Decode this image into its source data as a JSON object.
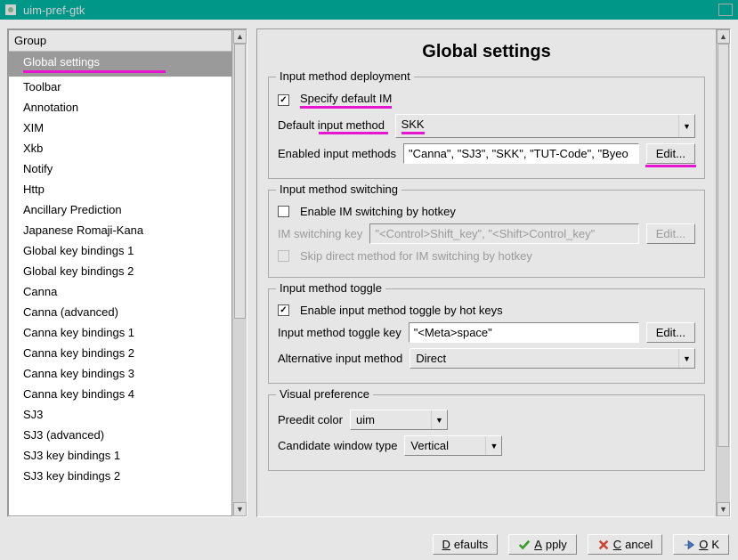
{
  "window": {
    "title": "uim-pref-gtk"
  },
  "sidebar": {
    "header": "Group",
    "items": [
      "Global settings",
      "Toolbar",
      "Annotation",
      "XIM",
      "Xkb",
      "Notify",
      "Http",
      "Ancillary Prediction",
      "Japanese Romaji-Kana",
      "Global key bindings 1",
      "Global key bindings 2",
      "Canna",
      "Canna (advanced)",
      "Canna key bindings 1",
      "Canna key bindings 2",
      "Canna key bindings 3",
      "Canna key bindings 4",
      "SJ3",
      "SJ3 (advanced)",
      "SJ3 key bindings 1",
      "SJ3 key bindings 2"
    ],
    "selected_index": 0
  },
  "page": {
    "title": "Global settings",
    "groups": {
      "deployment": {
        "title": "Input method deployment",
        "specify_default_label": "Specify default IM",
        "specify_default_checked": true,
        "default_im_label": "Default input method",
        "default_im_value": "SKK",
        "enabled_im_label": "Enabled input methods",
        "enabled_im_value": "\"Canna\", \"SJ3\", \"SKK\", \"TUT-Code\", \"Byeo",
        "edit_label": "Edit..."
      },
      "switching": {
        "title": "Input method switching",
        "enable_label": "Enable IM switching by hotkey",
        "enable_checked": false,
        "key_label": "IM switching key",
        "key_value": "\"<Control>Shift_key\", \"<Shift>Control_key\"",
        "edit_label": "Edit...",
        "skip_label": "Skip direct method for IM switching by hotkey",
        "skip_checked": false
      },
      "toggle": {
        "title": "Input method toggle",
        "enable_label": "Enable input method toggle by hot keys",
        "enable_checked": true,
        "key_label": "Input method toggle key",
        "key_value": "\"<Meta>space\"",
        "edit_label": "Edit...",
        "alt_label": "Alternative input method",
        "alt_value": "Direct"
      },
      "visual": {
        "title": "Visual preference",
        "preedit_label": "Preedit color",
        "preedit_value": "uim",
        "candidate_label": "Candidate window type",
        "candidate_value": "Vertical"
      }
    }
  },
  "buttons": {
    "defaults": "Defaults",
    "apply": "Apply",
    "cancel": "Cancel",
    "ok": "OK"
  }
}
